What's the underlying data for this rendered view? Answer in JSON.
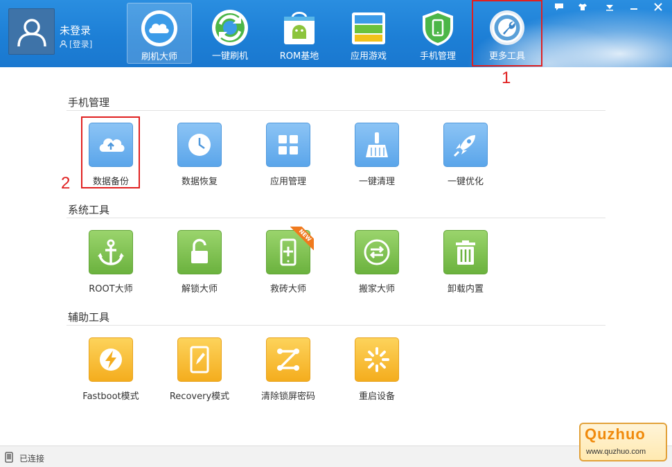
{
  "header": {
    "user": {
      "name": "未登录",
      "login_label": "[登录]"
    },
    "tabs": [
      {
        "label": "刷机大师",
        "icon": "cloud-icon",
        "active": true
      },
      {
        "label": "一键刷机",
        "icon": "refresh-cycle-icon"
      },
      {
        "label": "ROM基地",
        "icon": "android-bag-icon"
      },
      {
        "label": "应用游戏",
        "icon": "stacked-layers-icon"
      },
      {
        "label": "手机管理",
        "icon": "phone-shield-icon"
      },
      {
        "label": "更多工具",
        "icon": "wrench-gear-icon",
        "highlighted": true
      }
    ],
    "window_controls": [
      "chat-icon",
      "shirt-icon",
      "menu-down-icon",
      "minimize-icon",
      "close-icon"
    ]
  },
  "annotations": {
    "one": "1",
    "two": "2"
  },
  "sections": [
    {
      "title": "手机管理",
      "color": "#5aa5ea",
      "tools": [
        {
          "label": "数据备份",
          "icon": "cloud-upload-icon",
          "highlighted": true
        },
        {
          "label": "数据恢复",
          "icon": "clock-icon"
        },
        {
          "label": "应用管理",
          "icon": "app-grid-icon"
        },
        {
          "label": "一键清理",
          "icon": "broom-icon"
        },
        {
          "label": "一键优化",
          "icon": "rocket-icon"
        }
      ]
    },
    {
      "title": "系统工具",
      "color": "#6bb23e",
      "tools": [
        {
          "label": "ROOT大师",
          "icon": "anchor-icon"
        },
        {
          "label": "解锁大师",
          "icon": "unlock-icon"
        },
        {
          "label": "救砖大师",
          "icon": "phone-plus-icon",
          "badge": "NEW"
        },
        {
          "label": "搬家大师",
          "icon": "transfer-icon"
        },
        {
          "label": "卸载内置",
          "icon": "trash-icon"
        }
      ]
    },
    {
      "title": "辅助工具",
      "color": "#f4ad1e",
      "tools": [
        {
          "label": "Fastboot模式",
          "icon": "lightning-icon"
        },
        {
          "label": "Recovery模式",
          "icon": "tablet-edit-icon"
        },
        {
          "label": "清除锁屏密码",
          "icon": "pattern-lock-icon"
        },
        {
          "label": "重启设备",
          "icon": "loading-spinner-icon"
        }
      ]
    }
  ],
  "status": {
    "text": "已连接",
    "icon": "phone-status-icon"
  },
  "watermark": {
    "brand": "Quzhuo",
    "url": "www.quzhuo.com"
  }
}
